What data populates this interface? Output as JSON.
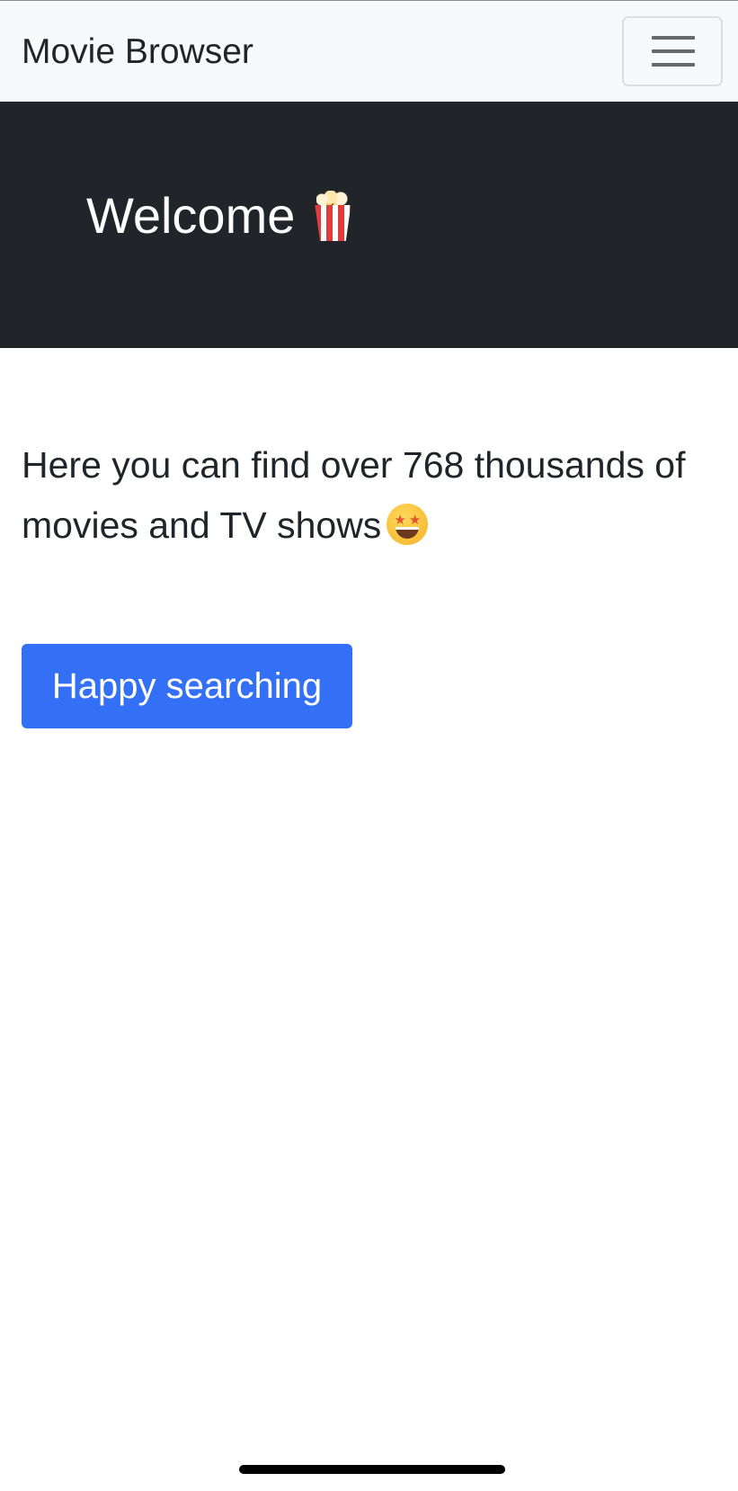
{
  "navbar": {
    "brand": "Movie Browser",
    "toggler_icon": "hamburger-menu-icon"
  },
  "hero": {
    "title": "Welcome",
    "title_icon": "popcorn-icon"
  },
  "intro": {
    "text": "Here you can find over 768 thousands of movies and TV shows",
    "emoji_icon": "star-struck-face-icon"
  },
  "cta": {
    "label": "Happy searching"
  },
  "colors": {
    "navbar_bg": "#f8f9fa",
    "hero_bg": "#212529",
    "primary": "#3470f5",
    "text": "#212529"
  }
}
